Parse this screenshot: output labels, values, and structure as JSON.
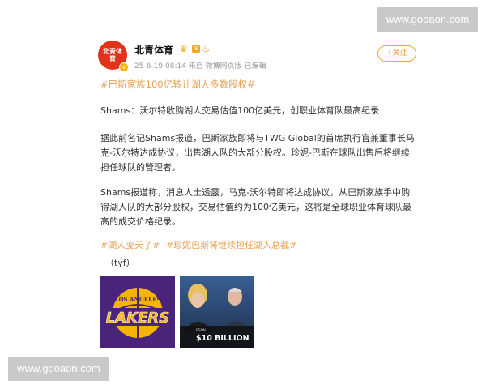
{
  "watermarks": {
    "top": "www.gooaon.com",
    "bottom": "www.gooaon.com"
  },
  "post": {
    "author": "北青体育",
    "vip_level": "8",
    "time": "25-6-19 08:14",
    "source": "来自 微博网页版",
    "edited": "已编辑",
    "follow_label": "+关注",
    "topic": "#巴斯家族100亿转让湖人多数股权#",
    "para1": "Shams：沃尔特收购湖人交易估值100亿美元，创职业体育队最高纪录",
    "para2": "据此前名记Shams报道，巴斯家族即将与TWG Global的首席执行官兼董事长马克-沃尔特达成协议，出售湖人队的大部分股权。珍妮-巴斯在球队出售后将继续担任球队的管理者。",
    "para3": "Shams报道称，消息人士透露，马克-沃尔特即将达成协议，从巴斯家族手中购得湖人队的大部分股权，交易估值约为100亿美元，这将是全球职业体育球队最高的成交价格纪录。",
    "tags": [
      "#湖人变天了#",
      "#珍妮巴斯将继续担任湖人总裁#"
    ],
    "signature": "（tyf）",
    "avatar_text": "北青体育"
  },
  "images": {
    "logo_top": "LOS ANGELES",
    "logo_main": "LAKERS",
    "espn": "ESPN",
    "caption": "$10 BILLION"
  },
  "colors": {
    "topic": "#e9a04f",
    "lakers_purple": "#4a237a",
    "lakers_gold": "#f4b400"
  }
}
